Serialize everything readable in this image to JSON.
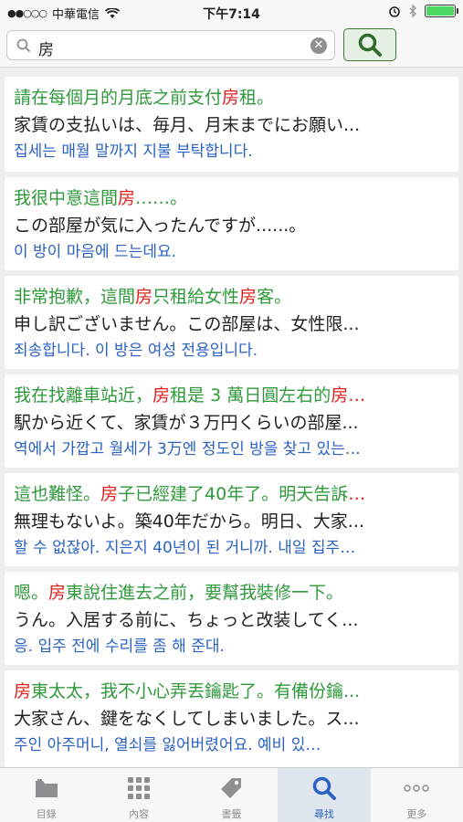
{
  "status_bar": {
    "carrier": "中華電信",
    "time": "下午7:14"
  },
  "search": {
    "query": "房",
    "search_button_icon": "search-icon",
    "clear_icon": "clear-icon"
  },
  "results": [
    {
      "zh": [
        {
          "t": "請在每個月的月底之前支付"
        },
        {
          "t": "房",
          "h": true
        },
        {
          "t": "租。"
        }
      ],
      "ja": "家賃の支払いは、毎月、月末までにお願い...",
      "ko": "집세는 매월 말까지 지불 부탁합니다."
    },
    {
      "zh": [
        {
          "t": "我很中意這間"
        },
        {
          "t": "房",
          "h": true
        },
        {
          "t": "……。"
        }
      ],
      "ja": "この部屋が気に入ったんですが......。",
      "ko": "이 방이 마음에 드는데요."
    },
    {
      "zh": [
        {
          "t": "非常抱歉，這間"
        },
        {
          "t": "房",
          "h": true
        },
        {
          "t": "只租給女性"
        },
        {
          "t": "房",
          "h": true
        },
        {
          "t": "客。"
        }
      ],
      "ja": "申し訳ございません。この部屋は、女性限...",
      "ko": "죄송합니다. 이 방은 여성 전용입니다."
    },
    {
      "zh": [
        {
          "t": "我在找離車站近，"
        },
        {
          "t": "房",
          "h": true
        },
        {
          "t": "租是 3 萬日圓左右的"
        },
        {
          "t": "房…",
          "h": true
        }
      ],
      "ja": "駅から近くて、家賃が３万円くらいの部屋...",
      "ko": "역에서 가깝고 월세가 3万엔 정도인 방을 찾고 있는…"
    },
    {
      "zh": [
        {
          "t": "這也難怪。"
        },
        {
          "t": "房",
          "h": true
        },
        {
          "t": "子已經建了40年了。明天告訴"
        },
        {
          "t": "…",
          "h": true
        }
      ],
      "ja": "無理もないよ。築40年だから。明日、大家...",
      "ko": "할 수 없잖아. 지은지 40년이 된 거니까. 내일 집주…"
    },
    {
      "zh": [
        {
          "t": "嗯。"
        },
        {
          "t": "房",
          "h": true
        },
        {
          "t": "東說住進去之前，要幫我裝修一下。"
        }
      ],
      "ja": "うん。入居する前に、ちょっと改装してく...",
      "ko": "응. 입주 전에 수리를 좀 해 준대."
    },
    {
      "zh": [
        {
          "t": "房",
          "h": true
        },
        {
          "t": "東太太，我不小心弄丟鑰匙了。有備份鑰..."
        }
      ],
      "ja": "大家さん、鍵をなくしてしまいました。ス...",
      "ko": "주인 아주머니, 열쇠를 잃어버렸어요. 예비 있…"
    }
  ],
  "tabs": [
    {
      "label": "目錄",
      "icon": "folder-icon",
      "active": false
    },
    {
      "label": "內容",
      "icon": "grid-icon",
      "active": false
    },
    {
      "label": "書籤",
      "icon": "tag-icon",
      "active": false
    },
    {
      "label": "尋找",
      "icon": "search-icon",
      "active": true
    },
    {
      "label": "更多",
      "icon": "more-icon",
      "active": false
    }
  ]
}
